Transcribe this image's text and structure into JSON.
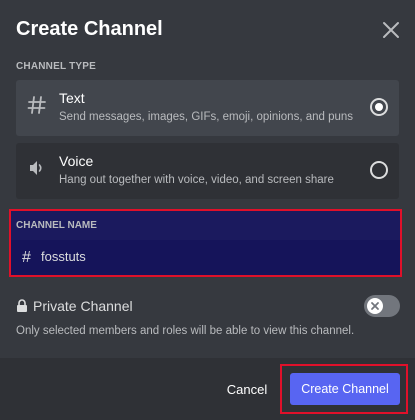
{
  "dialog": {
    "title": "Create Channel",
    "close_icon": "close-icon"
  },
  "channel_type": {
    "section_label": "CHANNEL TYPE",
    "options": [
      {
        "icon": "hash-icon",
        "title": "Text",
        "description": "Send messages, images, GIFs, emoji, opinions, and puns",
        "selected": true
      },
      {
        "icon": "speaker-icon",
        "title": "Voice",
        "description": "Hang out together with voice, video, and screen share",
        "selected": false
      }
    ]
  },
  "channel_name": {
    "section_label": "CHANNEL NAME",
    "prefix": "#",
    "value": "fosstuts"
  },
  "private_channel": {
    "icon": "lock-icon",
    "label": "Private Channel",
    "enabled": false,
    "description": "Only selected members and roles will be able to view this channel."
  },
  "footer": {
    "cancel_label": "Cancel",
    "create_label": "Create Channel"
  },
  "colors": {
    "background": "#36393f",
    "footer": "#2f3136",
    "selected_option": "#42464d",
    "accent": "#5865f2",
    "highlight_border": "#e0102a",
    "name_highlight": "#15145a"
  }
}
